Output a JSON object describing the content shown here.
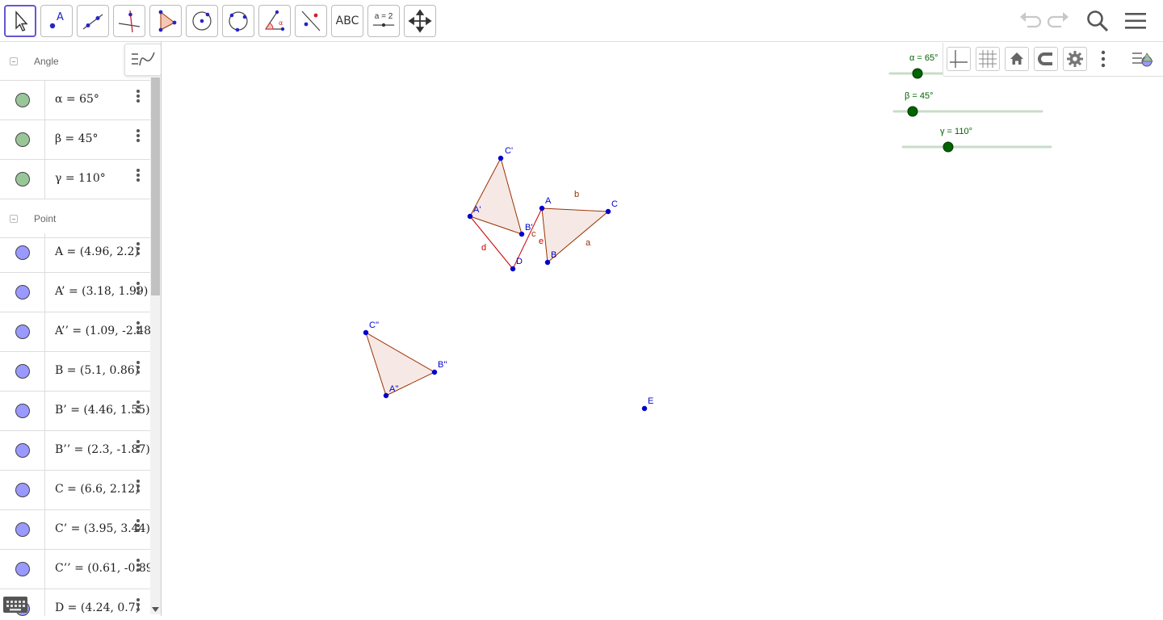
{
  "toolbar": {
    "tools": [
      {
        "name": "move-tool",
        "icon": "cursor-arrow-icon"
      },
      {
        "name": "point-tool",
        "icon": "point-icon",
        "glyph": "A"
      },
      {
        "name": "segment-tool",
        "icon": "segment-icon"
      },
      {
        "name": "perpendicular-line-tool",
        "icon": "perpendicular-icon"
      },
      {
        "name": "polygon-tool",
        "icon": "polygon-icon"
      },
      {
        "name": "circle-center-point-tool",
        "icon": "circle-center-icon"
      },
      {
        "name": "circle-three-points-tool",
        "icon": "circle-three-points-icon"
      },
      {
        "name": "angle-tool",
        "icon": "angle-icon"
      },
      {
        "name": "reflect-about-line-tool",
        "icon": "reflect-icon"
      },
      {
        "name": "text-tool",
        "icon": "text-icon",
        "label": "ABC"
      },
      {
        "name": "slider-tool",
        "icon": "slider-icon",
        "label": "a = 2"
      },
      {
        "name": "move-graphics-view-tool",
        "icon": "move-view-icon"
      }
    ],
    "right": [
      "undo-icon",
      "redo-icon",
      "search-icon",
      "menu-icon"
    ]
  },
  "algebra": {
    "groups": [
      {
        "name": "Angle",
        "items": [
          {
            "label": "α = 65°",
            "color": "#99c699"
          },
          {
            "label": "β = 45°",
            "color": "#99c699"
          },
          {
            "label": "γ = 110°",
            "color": "#99c699"
          }
        ]
      },
      {
        "name": "Point",
        "items": [
          {
            "label": "A = (4.96, 2.2)",
            "color": "#9999ff"
          },
          {
            "label": "A’ = (3.18, 1.99)",
            "color": "#9999ff"
          },
          {
            "label": "A’’ = (1.09, -2.48)",
            "color": "#9999ff"
          },
          {
            "label": "B = (5.1, 0.86)",
            "color": "#9999ff"
          },
          {
            "label": "B’ = (4.46, 1.55)",
            "color": "#9999ff"
          },
          {
            "label": "B’’ = (2.3, -1.87)",
            "color": "#9999ff"
          },
          {
            "label": "C = (6.6, 2.12)",
            "color": "#9999ff"
          },
          {
            "label": "C’ = (3.95, 3.44)",
            "color": "#9999ff"
          },
          {
            "label": "C’’ = (0.61, -0.89)",
            "color": "#9999ff"
          },
          {
            "label": "D = (4.24, 0.7)",
            "color": "#9999ff"
          }
        ]
      }
    ]
  },
  "graphics": {
    "style_bar_icons": [
      "axes-toggle-icon",
      "grid-toggle-icon",
      "home-icon",
      "snap-magnet-icon",
      "settings-gear-icon",
      "more-vertical-icon"
    ],
    "sliders": [
      {
        "label": "α = 65°",
        "value": 65,
        "min": 0,
        "max": 360
      },
      {
        "label": "β = 45°",
        "value": 45,
        "min": 0,
        "max": 360
      },
      {
        "label": "γ = 110°",
        "value": 110,
        "min": 0,
        "max": 360
      }
    ],
    "points": [
      {
        "label": "A"
      },
      {
        "label": "B"
      },
      {
        "label": "C"
      },
      {
        "label": "A'"
      },
      {
        "label": "B'"
      },
      {
        "label": "C'"
      },
      {
        "label": "A''"
      },
      {
        "label": "B''"
      },
      {
        "label": "C''"
      },
      {
        "label": "D"
      },
      {
        "label": "E"
      }
    ],
    "segment_labels": [
      "a",
      "b",
      "c",
      "d",
      "e"
    ],
    "colors": {
      "point": "#0000cc",
      "polygon_edge": "#993300",
      "polygon_fill": "#f6e8e4",
      "slider_label": "#006400",
      "slider_knob": "#006400",
      "segment_label": "#cc0000"
    }
  }
}
